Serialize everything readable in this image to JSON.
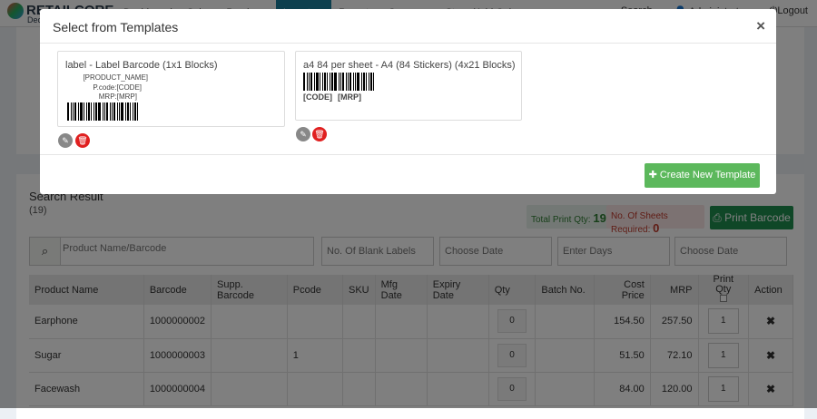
{
  "app": {
    "name": "RETAILCORE",
    "sub": "Dec"
  },
  "nav": [
    "Dashboard",
    "Sales",
    "Purchase",
    "Inventory",
    "Reports",
    "Company",
    "Store (Add On)"
  ],
  "nav_active": 3,
  "topbar": {
    "search_placeholder": "Search",
    "user": "Administrator",
    "logout": "Logout"
  },
  "modal": {
    "title": "Select from Templates",
    "close": "×",
    "create_button": "Create New Template",
    "templates": [
      {
        "name": "label - Label Barcode (1x1 Blocks)",
        "fields": [
          "[PRODUCT_NAME]",
          "P.code:[CODE]",
          "MRP:[MRP]"
        ]
      },
      {
        "name": "a4 84 per sheet - A4 (84 Stickers) (4x21 Blocks)",
        "code": "[CODE]",
        "mrp": "[MRP]"
      }
    ]
  },
  "search_result": {
    "title": "Search Result",
    "count": "(19)",
    "total_print_qty_label": "Total Print Qty:",
    "total_print_qty": "19",
    "sheets_required_label": "No. Of Sheets Required:",
    "sheets_required": "0",
    "print_button": "Print Barcode"
  },
  "filters": {
    "product_placeholder": "Product Name/Barcode",
    "blank_labels_placeholder": "No. Of Blank Labels",
    "date1_placeholder": "Choose Date",
    "days_placeholder": "Enter Days",
    "date2_placeholder": "Choose Date"
  },
  "table": {
    "headers": [
      "Product Name",
      "Barcode",
      "Supp. Barcode",
      "Pcode",
      "SKU",
      "Mfg Date",
      "Expiry Date",
      "Qty",
      "Batch No.",
      "Cost Price",
      "MRP",
      "Print Qty",
      "Action"
    ],
    "rows": [
      {
        "name": "Earphone",
        "barcode": "1000000002",
        "supp": "",
        "pcode": "",
        "sku": "",
        "mfg": "",
        "exp": "",
        "qty": "0",
        "batch": "",
        "cost": "154.50",
        "mrp": "257.50",
        "print_qty": "1"
      },
      {
        "name": "Sugar",
        "barcode": "1000000003",
        "supp": "",
        "pcode": "1",
        "sku": "",
        "mfg": "",
        "exp": "",
        "qty": "0",
        "batch": "",
        "cost": "51.50",
        "mrp": "72.10",
        "print_qty": "1"
      },
      {
        "name": "Facewash",
        "barcode": "1000000004",
        "supp": "",
        "pcode": "",
        "sku": "",
        "mfg": "",
        "exp": "",
        "qty": "0",
        "batch": "",
        "cost": "84.00",
        "mrp": "120.00",
        "print_qty": "1"
      }
    ]
  },
  "colors": {
    "accent": "#1a7f9c",
    "green": "#1e8e4e",
    "create": "#5cb85c",
    "danger": "#e02020"
  }
}
